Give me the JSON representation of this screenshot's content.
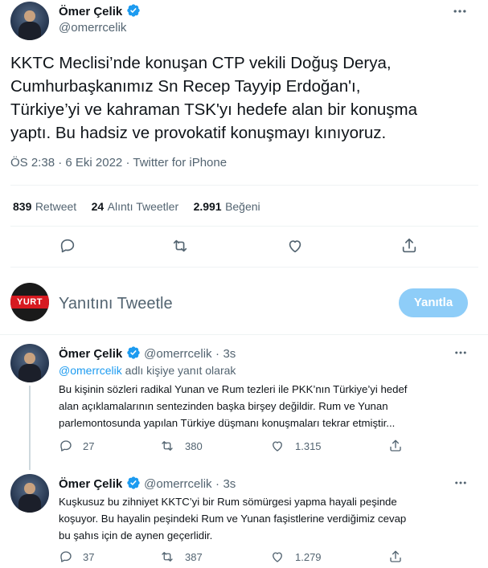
{
  "main_tweet": {
    "author_name": "Ömer Çelik",
    "author_handle": "@omerrcelik",
    "text_lines": [
      "KKTC Meclisi’nde konuşan CTP vekili Doğuş Derya,",
      "Cumhurbaşkanımız Sn  Recep Tayyip Erdoğan'ı,",
      "Türkiye’yi ve kahraman TSK'yı hedefe alan bir konuşma",
      "yaptı. Bu hadsiz ve provokatif konuşmayı kınıyoruz."
    ],
    "time": "ÖS 2:38",
    "separator": "·",
    "date": "6 Eki 2022",
    "source": "Twitter for iPhone"
  },
  "stats": {
    "retweet_count": "839",
    "retweet_label": "Retweet",
    "quote_count": "24",
    "quote_label": "Alıntı Tweetler",
    "like_count": "2.991",
    "like_label": "Beğeni"
  },
  "reply_composer": {
    "logo_text": "YURT",
    "placeholder": "Yanıtını Tweetle",
    "button_label": "Yanıtla"
  },
  "replies": [
    {
      "author_name": "Ömer Çelik",
      "author_handle": "@omerrcelik",
      "separator": "·",
      "time": "3s",
      "replying_handle": "@omerrcelik",
      "replying_suffix": "adlı kişiye yanıt olarak",
      "text_lines": [
        "Bu kişinin sözleri radikal Yunan ve Rum tezleri ile PKK’nın Türkiye’yi hedef",
        "alan açıklamalarının sentezinden başka birşey değildir. Rum ve Yunan",
        "parlemontosunda yapılan Türkiye düşmanı konuşmaları tekrar etmiştir..."
      ],
      "reply_count": "27",
      "retweet_count": "380",
      "like_count": "1.315"
    },
    {
      "author_name": "Ömer Çelik",
      "author_handle": "@omerrcelik",
      "separator": "·",
      "time": "3s",
      "text_lines": [
        "Kuşkusuz bu zihniyet KKTC’yi bir Rum sömürgesi yapma hayali peşinde",
        "koşuyor. Bu hayalin peşindeki Rum ve Yunan faşistlerine verdiğimiz cevap",
        "bu şahıs için de aynen geçerlidir."
      ],
      "reply_count": "37",
      "retweet_count": "387",
      "like_count": "1.279"
    }
  ],
  "colors": {
    "accent": "#1d9bf0",
    "reply_button": "#8ecdf8",
    "muted": "#536471",
    "divider": "#eff3f4",
    "logo_red": "#d71a21"
  },
  "icons": [
    "verified-badge-icon",
    "more-icon",
    "reply-icon",
    "retweet-icon",
    "like-icon",
    "share-icon"
  ]
}
